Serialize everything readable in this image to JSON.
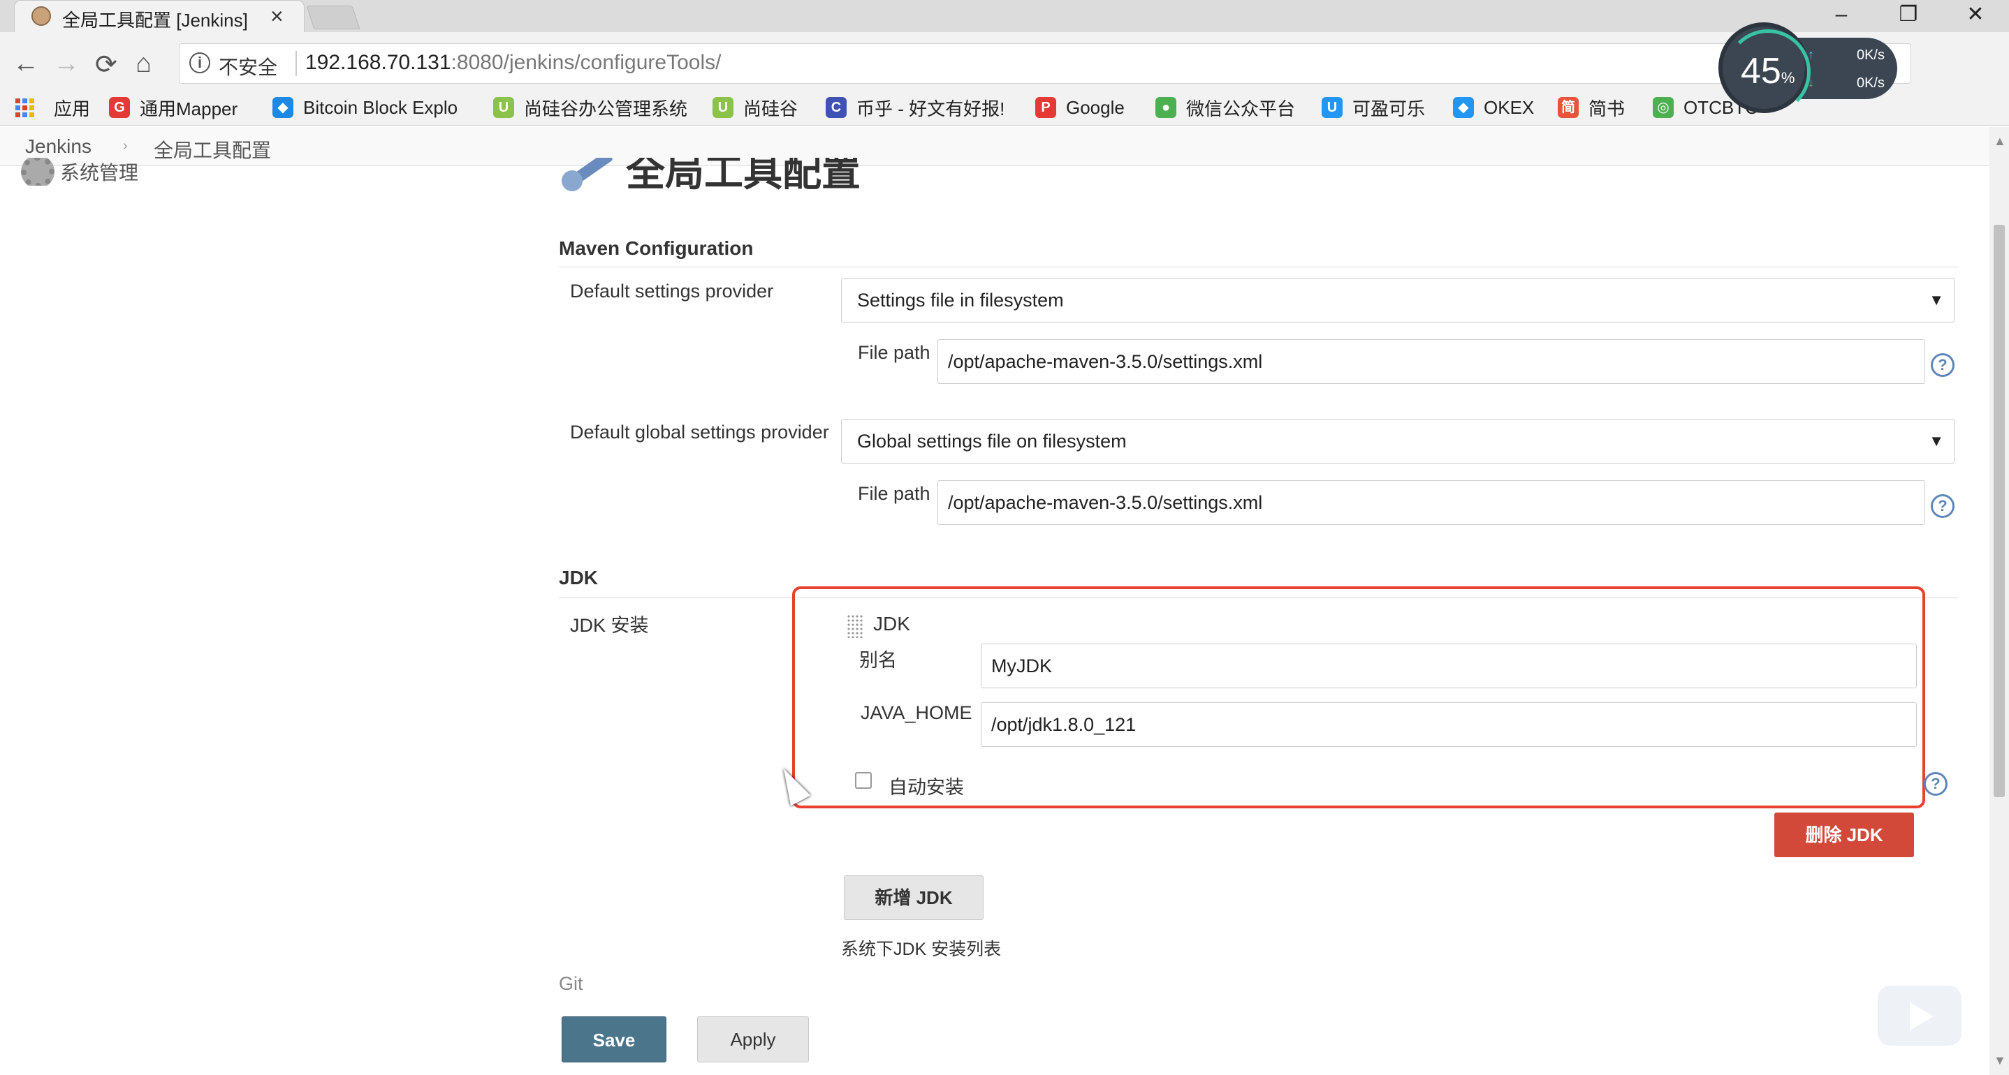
{
  "browser": {
    "tab_title": "全局工具配置 [Jenkins]",
    "tab_close": "×",
    "insecure_label": "不安全",
    "url_host": "192.168.70.131",
    "url_rest": ":8080/jenkins/configureTools/",
    "window_controls": [
      "–",
      "❐",
      "✕"
    ],
    "nav": {
      "back": "←",
      "forward": "→",
      "reload": "⟳",
      "home": "⌂"
    },
    "bookmarks": [
      {
        "label": "应用",
        "icon": "apps-grid"
      },
      {
        "label": "通用Mapper",
        "icon": "G",
        "color": "#e53935"
      },
      {
        "label": "Bitcoin Block Explo",
        "icon": "◆",
        "color": "#1e88e5"
      },
      {
        "label": "尚硅谷办公管理系统",
        "icon": "U",
        "color": "#8bc34a"
      },
      {
        "label": "尚硅谷",
        "icon": "U",
        "color": "#8bc34a"
      },
      {
        "label": "币乎 - 好文有好报!",
        "icon": "C",
        "color": "#3f51b5"
      },
      {
        "label": "Google",
        "icon": "P",
        "color": "#e53935"
      },
      {
        "label": "微信公众平台",
        "icon": "●",
        "color": "#4caf50"
      },
      {
        "label": "可盈可乐",
        "icon": "U",
        "color": "#2196f3"
      },
      {
        "label": "OKEX",
        "icon": "◆",
        "color": "#2196f3"
      },
      {
        "label": "简书",
        "icon": "简",
        "color": "#e8543b"
      },
      {
        "label": "OTCBTC",
        "icon": "◎",
        "color": "#4caf50"
      }
    ],
    "speed": {
      "percent": "45",
      "percent_unit": "%",
      "up": "0K/s",
      "down": "0K/s"
    }
  },
  "breadcrumb": [
    "Jenkins",
    "全局工具配置"
  ],
  "sidebar": {
    "item_label": "系统管理"
  },
  "page": {
    "title": "全局工具配置"
  },
  "maven": {
    "heading": "Maven Configuration",
    "default_settings_label": "Default settings provider",
    "default_settings_value": "Settings file in filesystem",
    "file_path_label": "File path",
    "file_path_value": "/opt/apache-maven-3.5.0/settings.xml",
    "global_settings_label": "Default global settings provider",
    "global_settings_value": "Global settings file on filesystem",
    "global_file_path_label": "File path",
    "global_file_path_value": "/opt/apache-maven-3.5.0/settings.xml"
  },
  "jdk": {
    "heading": "JDK",
    "install_label": "JDK 安装",
    "block_title": "JDK",
    "alias_label": "别名",
    "alias_value": "MyJDK",
    "java_home_label": "JAVA_HOME",
    "java_home_value": "/opt/jdk1.8.0_121",
    "auto_install_label": "自动安装",
    "auto_install_checked": false,
    "delete_button": "删除 JDK",
    "add_button": "新增 JDK",
    "list_caption": "系统下JDK 安装列表"
  },
  "git": {
    "heading": "Git"
  },
  "actions": {
    "save": "Save",
    "apply": "Apply"
  },
  "colors": {
    "highlight": "#e8412f",
    "danger": "#d24939",
    "save": "#4b758b"
  }
}
